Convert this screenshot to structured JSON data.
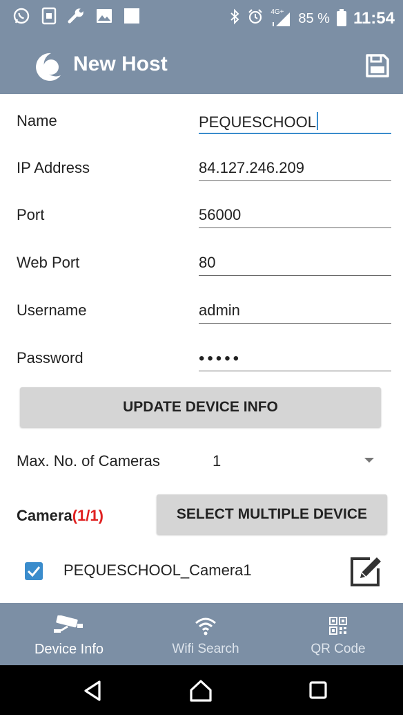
{
  "status_bar": {
    "left_icons": [
      "whatsapp-icon",
      "sim-card-icon",
      "wrench-icon",
      "gallery-icon",
      "notification-square-icon"
    ],
    "right_icons": [
      "bluetooth-icon",
      "alarm-icon",
      "network-4g-icon"
    ],
    "network_label": "4G+",
    "battery": "85 %",
    "time": "11:54"
  },
  "app_bar": {
    "title": "New Host",
    "logo_icon": "app-moon-logo-icon",
    "save_icon": "save-icon"
  },
  "form": {
    "fields": [
      {
        "label": "Name",
        "value": "PEQUESCHOOL"
      },
      {
        "label": "IP Address",
        "value": "84.127.246.209"
      },
      {
        "label": "Port",
        "value": "56000"
      },
      {
        "label": "Web Port",
        "value": "80"
      },
      {
        "label": "Username",
        "value": "admin"
      },
      {
        "label": "Password",
        "value": "•••••"
      }
    ]
  },
  "update_button": "UPDATE DEVICE INFO",
  "max_cameras": {
    "label": "Max. No. of Cameras",
    "value": "1"
  },
  "camera_section": {
    "title": "Camera",
    "count": "(1/1)",
    "select_multiple_button": "SELECT MULTIPLE DEVICE"
  },
  "cameras": [
    {
      "name": "PEQUESCHOOL_Camera1",
      "checked": true
    }
  ],
  "tab_bar": {
    "tabs": [
      {
        "label": "Device Info",
        "icon": "cctv-camera-icon",
        "active": true
      },
      {
        "label": "Wifi Search",
        "icon": "wifi-icon",
        "active": false
      },
      {
        "label": "QR Code",
        "icon": "qr-code-icon",
        "active": false
      }
    ]
  },
  "colors": {
    "bar": "#7c8fa5",
    "accent": "#3a8ccc",
    "camera_count": "#e02020",
    "button": "#d5d5d5"
  }
}
